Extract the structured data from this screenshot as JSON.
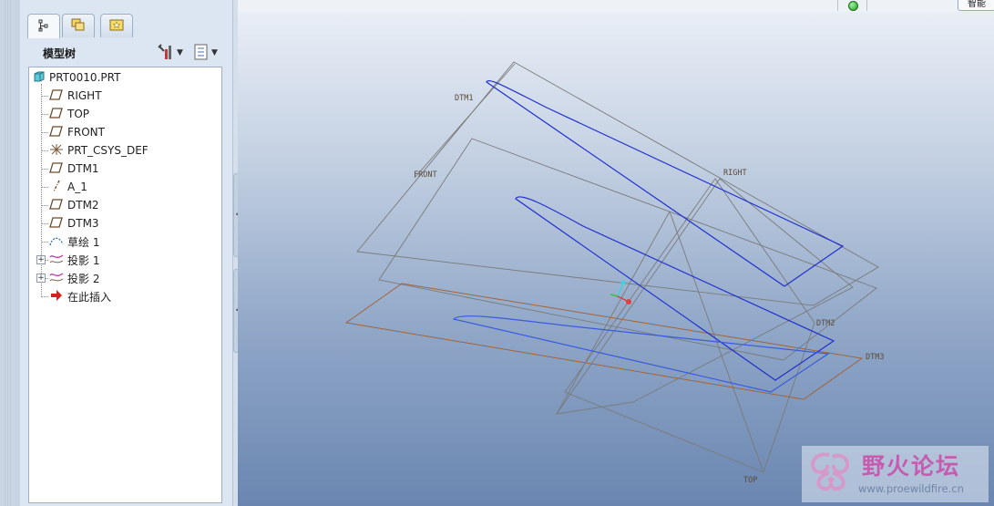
{
  "navigator": {
    "tabs": [
      {
        "icon": "model-tree-tab-icon",
        "active": true
      },
      {
        "icon": "folder-browser-tab-icon",
        "active": false
      },
      {
        "icon": "favorites-tab-icon",
        "active": false
      }
    ],
    "title": "模型树",
    "settings_icon": "tools-icon",
    "show_icon": "list-icon"
  },
  "tree": {
    "root": "PRT0010.PRT",
    "items": [
      {
        "label": "RIGHT",
        "icon": "datum-plane-icon"
      },
      {
        "label": "TOP",
        "icon": "datum-plane-icon"
      },
      {
        "label": "FRONT",
        "icon": "datum-plane-icon"
      },
      {
        "label": "PRT_CSYS_DEF",
        "icon": "coordinate-system-icon"
      },
      {
        "label": "DTM1",
        "icon": "datum-plane-icon"
      },
      {
        "label": "A_1",
        "icon": "datum-axis-icon"
      },
      {
        "label": "DTM2",
        "icon": "datum-plane-icon"
      },
      {
        "label": "DTM3",
        "icon": "datum-plane-icon"
      },
      {
        "label": "草绘 1",
        "icon": "sketch-icon"
      },
      {
        "label": "投影 1",
        "icon": "projection-icon",
        "expandable": true
      },
      {
        "label": "投影 2",
        "icon": "projection-icon",
        "expandable": true
      },
      {
        "label": "在此插入",
        "icon": "insert-here-arrow-icon"
      }
    ]
  },
  "statusbar": {
    "smart_filter": "智能"
  },
  "scene": {
    "labels": {
      "dtm1": "DTM1",
      "front": "FRONT",
      "right": "RIGHT",
      "dtm2": "DTM2",
      "dtm3": "DTM3",
      "top": "TOP"
    },
    "colors": {
      "datum_planes": "#7a7a7a",
      "dtm3_plane": "#a0643c",
      "curves": "#1f2fd0"
    }
  },
  "watermark": {
    "title": "野火论坛",
    "url": "www.proewildfire.cn"
  }
}
